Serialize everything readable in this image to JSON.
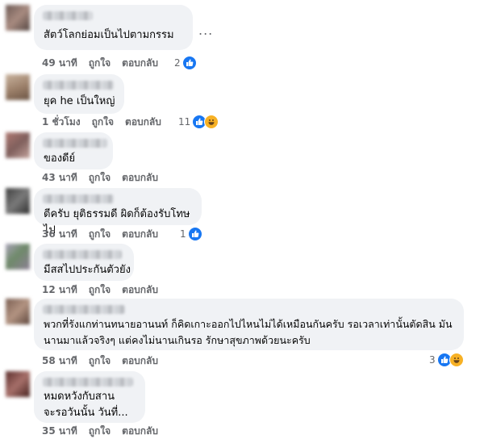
{
  "comments": [
    {
      "text": "สัตว์โลกย่อมเป็นไปตามกรรม",
      "time": "49 นาที",
      "like_label": "ถูกใจ",
      "reply_label": "ตอบกลับ",
      "reaction_count": "2",
      "reactions": [
        "like"
      ],
      "avatar_color": "#8a7068"
    },
    {
      "text": "ยุค he เป็นใหญ่",
      "time": "1 ชั่วโมง",
      "like_label": "ถูกใจ",
      "reply_label": "ตอบกลับ",
      "reaction_count": "11",
      "reactions": [
        "like",
        "haha"
      ],
      "avatar_color": "#a38a74"
    },
    {
      "text": "ของดีย์",
      "time": "43 นาที",
      "like_label": "ถูกใจ",
      "reply_label": "ตอบกลับ",
      "reaction_count": "",
      "reactions": [],
      "avatar_color": "#9c6f6a"
    },
    {
      "text": "ตีครับ ยุติธรรมดี ผิดก็ต้องรับโทษไป",
      "time": "36 นาที",
      "like_label": "ถูกใจ",
      "reply_label": "ตอบกลับ",
      "reaction_count": "1",
      "reactions": [
        "like"
      ],
      "avatar_color": "#5e5e5e"
    },
    {
      "text": "มีสสไปประกันตัวยัง",
      "time": "12 นาที",
      "like_label": "ถูกใจ",
      "reply_label": "ตอบกลับ",
      "reaction_count": "",
      "reactions": [],
      "avatar_color": "#8f8c9a"
    },
    {
      "text": "พวกที่รังแกท่านทนายอานนท์ ก็คิดเกาะออกไปไหนไม่ได้เหมือนกันครับ รอเวลาเท่านั้นตัดสิน มัน\nนานมาแล้วจริงๆ แต่คงไม่นานเกินรอ รักษาสุขภาพด้วยนะครับ",
      "time": "58 นาที",
      "like_label": "ถูกใจ",
      "reply_label": "ตอบกลับ",
      "reaction_count": "3",
      "reactions": [
        "like",
        "haha"
      ],
      "avatar_color": "#96786a"
    },
    {
      "text": "หมดหวังกับสาน\nจะรอวันนั้น วันที่...",
      "time": "35 นาที",
      "like_label": "ถูกใจ",
      "reply_label": "ตอบกลับ",
      "reaction_count": "",
      "reactions": [],
      "avatar_color": "#7c4e4a"
    }
  ],
  "more_options_label": "...",
  "colors": {
    "like": "#1877f2",
    "haha": "#f7b125",
    "bubble": "#f0f2f5",
    "meta": "#65676b"
  }
}
